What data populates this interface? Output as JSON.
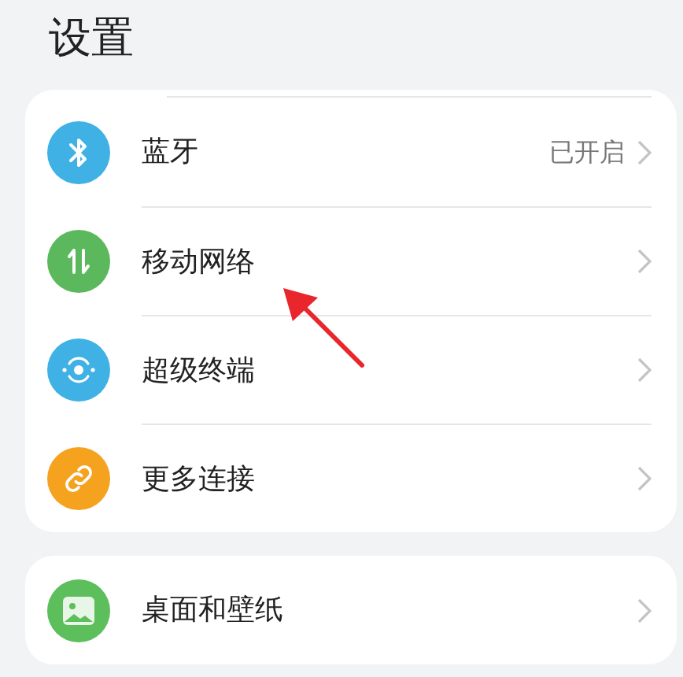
{
  "title": "设置",
  "groups": [
    {
      "items": [
        {
          "kind": "bluetooth",
          "color": "#3fb1e5",
          "label": "蓝牙",
          "value": "已开启"
        },
        {
          "kind": "mobile-data",
          "color": "#5cb85c",
          "label": "移动网络"
        },
        {
          "kind": "super-device",
          "color": "#3fb1e5",
          "label": "超级终端"
        },
        {
          "kind": "link",
          "color": "#f5a21f",
          "label": "更多连接"
        }
      ]
    },
    {
      "items": [
        {
          "kind": "wallpaper",
          "color": "#5cbf5c",
          "label": "桌面和壁纸"
        }
      ]
    }
  ]
}
